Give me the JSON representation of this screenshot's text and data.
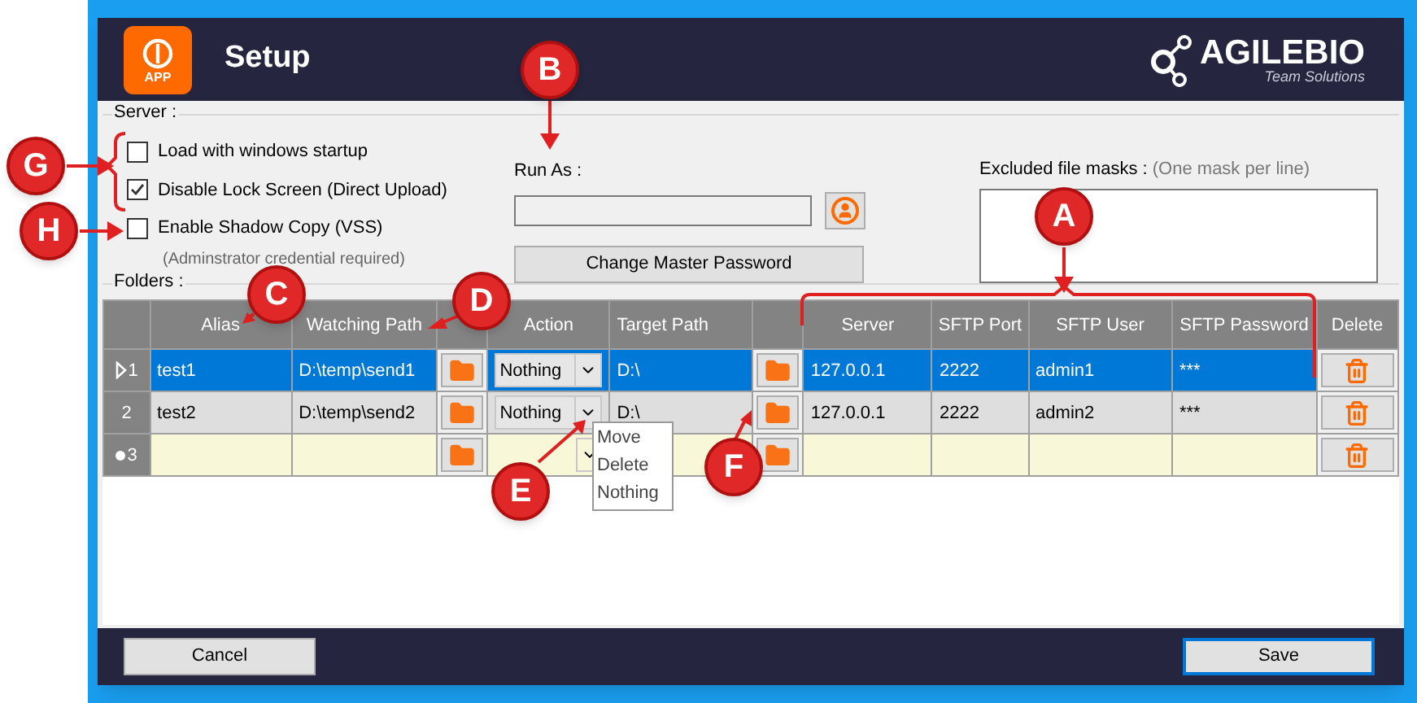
{
  "window": {
    "title": "Setup"
  },
  "logo": {
    "app_label": "APP",
    "brand": "AGILEBIO",
    "tagline": "Team Solutions"
  },
  "server": {
    "legend": "Server :",
    "options": [
      {
        "label": "Load with windows startup",
        "checked": false
      },
      {
        "label": "Disable Lock Screen (Direct Upload)",
        "checked": true
      },
      {
        "label": "Enable Shadow Copy (VSS)",
        "checked": false,
        "note": "(Adminstrator credential required)"
      }
    ],
    "run_as": {
      "label": "Run As :"
    },
    "change_password_button": "Change Master Password",
    "excluded_masks": {
      "label": "Excluded file masks :",
      "hint": "(One mask per line)"
    }
  },
  "folders": {
    "legend": "Folders :",
    "columns": [
      "Alias",
      "Watching Path",
      "Action",
      "Target Path",
      "Server",
      "SFTP Port",
      "SFTP User",
      "SFTP Password",
      "Delete"
    ],
    "rows": [
      {
        "kind": "row",
        "number": "1",
        "selected": true,
        "alias": "test1",
        "watching_path": "D:\\temp\\send1",
        "action": "Nothing",
        "target_path": "D:\\",
        "server": "127.0.0.1",
        "sftp_port": "2222",
        "sftp_user": "admin1",
        "sftp_password": "***"
      },
      {
        "kind": "row",
        "number": "2",
        "selected": false,
        "alias": "test2",
        "watching_path": "D:\\temp\\send2",
        "action": "Nothing",
        "target_path": "D:\\",
        "server": "127.0.0.1",
        "sftp_port": "2222",
        "sftp_user": "admin2",
        "sftp_password": "***",
        "open_options": [
          "Move",
          "Delete",
          "Nothing"
        ]
      },
      {
        "kind": "new",
        "number": "3",
        "selected": false
      }
    ]
  },
  "buttons": {
    "cancel": "Cancel",
    "save": "Save"
  },
  "annotations": [
    {
      "label": "A"
    },
    {
      "label": "B"
    },
    {
      "label": "C"
    },
    {
      "label": "D"
    },
    {
      "label": "E"
    },
    {
      "label": "F"
    },
    {
      "label": "G"
    },
    {
      "label": "H"
    }
  ]
}
